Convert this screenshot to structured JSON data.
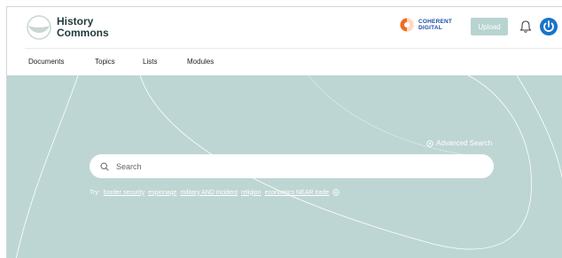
{
  "brand": {
    "name_line1": "History",
    "name_line2": "Commons"
  },
  "partner": {
    "line1": "COHERENT",
    "line2": "DIGITAL"
  },
  "header": {
    "upload_label": "Upload"
  },
  "nav": {
    "items": [
      "Documents",
      "Topics",
      "Lists",
      "Modules"
    ]
  },
  "search": {
    "placeholder": "Search",
    "advanced_label": "Advanced Search"
  },
  "try": {
    "label": "Try:",
    "examples": [
      "border security",
      "espionage",
      "military AND incident",
      "religion",
      "economics NEAR trade"
    ]
  },
  "colors": {
    "hero_bg": "#bdd6d3",
    "upload_bg": "#b8d4d0",
    "accent_blue": "#1a73c8",
    "orange": "#f26a21"
  }
}
